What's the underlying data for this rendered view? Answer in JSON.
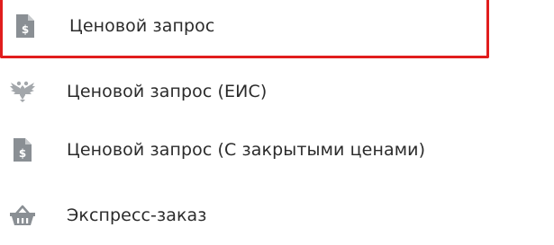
{
  "menu": {
    "items": [
      {
        "label": "Ценовой запрос",
        "icon": "price-document-icon",
        "selected": true
      },
      {
        "label": "Ценовой запрос (ЕИС)",
        "icon": "double-eagle-emblem-icon",
        "selected": false
      },
      {
        "label": "Ценовой запрос (С закрытыми ценами)",
        "icon": "price-document-icon",
        "selected": false
      },
      {
        "label": "Экспресс-заказ",
        "icon": "shopping-basket-icon",
        "selected": false
      }
    ]
  },
  "colors": {
    "selection_border": "#e11d1d",
    "icon": "#8a8f94",
    "text": "#2b2b2b"
  }
}
